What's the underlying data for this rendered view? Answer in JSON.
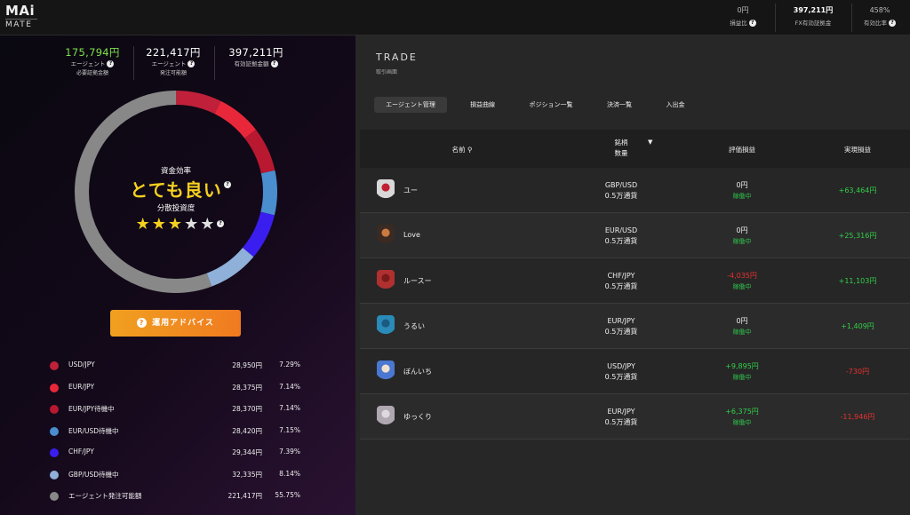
{
  "logo": {
    "line1": "MAi",
    "line2": "MATE"
  },
  "topbar": {
    "stats": [
      {
        "value": "0円",
        "label": "損益比"
      },
      {
        "value": "397,211円",
        "label": "FX有効証拠金"
      },
      {
        "value": "458%",
        "label": "有効比率"
      }
    ]
  },
  "kpis": [
    {
      "value": "175,794円",
      "label1": "エージェント",
      "label2": "必要証拠金額",
      "color": "#7fe04a"
    },
    {
      "value": "221,417円",
      "label1": "エージェント",
      "label2": "発注可能額",
      "color": "#ffffff"
    },
    {
      "value": "397,211円",
      "label1": "有効証拠金額",
      "label2": "",
      "color": "#ffffff"
    }
  ],
  "efficiency": {
    "label": "資金効率",
    "rating": "とても良い",
    "diversification_label": "分散投資度",
    "stars": 3,
    "stars_max": 5
  },
  "advice_button": "運用アドバイス",
  "allocation": [
    {
      "name": "USD/JPY",
      "amount": "28,950円",
      "pct": "7.29%",
      "share": 7.29,
      "color": "#c0203a"
    },
    {
      "name": "EUR/JPY",
      "amount": "28,375円",
      "pct": "7.14%",
      "share": 7.14,
      "color": "#e8283a"
    },
    {
      "name": "EUR/JPY待機中",
      "amount": "28,370円",
      "pct": "7.14%",
      "share": 7.14,
      "color": "#b81830"
    },
    {
      "name": "EUR/USD待機中",
      "amount": "28,420円",
      "pct": "7.15%",
      "share": 7.15,
      "color": "#4a8ed0"
    },
    {
      "name": "CHF/JPY",
      "amount": "29,344円",
      "pct": "7.39%",
      "share": 7.39,
      "color": "#3a1ef0"
    },
    {
      "name": "GBP/USD待機中",
      "amount": "32,335円",
      "pct": "8.14%",
      "share": 8.14,
      "color": "#8fb0d8"
    },
    {
      "name": "エージェント発注可能額",
      "amount": "221,417円",
      "pct": "55.75%",
      "share": 55.75,
      "color": "#888888"
    }
  ],
  "trade": {
    "title": "TRADE",
    "subtitle": "取引画面",
    "tabs": [
      "エージェント管理",
      "損益曲線",
      "ポジション一覧",
      "決済一覧",
      "入出金"
    ],
    "columns": {
      "name": "名前",
      "pair_top": "銘柄",
      "pair_bottom": "数量",
      "unrealized": "評価損益",
      "realized": "実現損益"
    },
    "rows": [
      {
        "name": "ユー",
        "pair": "GBP/USD",
        "qty": "0.5万通貨",
        "unrealized": "0円",
        "unrealized_sign": "zero",
        "status": "稼働中",
        "realized": "+63,464円",
        "realized_sign": "pos",
        "avatar_color": "#d8d8d8",
        "avatar_accent": "#c02030"
      },
      {
        "name": "Love",
        "pair": "EUR/USD",
        "qty": "0.5万通貨",
        "unrealized": "0円",
        "unrealized_sign": "zero",
        "status": "稼働中",
        "realized": "+25,316円",
        "realized_sign": "pos",
        "avatar_color": "#3a2a22",
        "avatar_accent": "#c87a40"
      },
      {
        "name": "ルースー",
        "pair": "CHF/JPY",
        "qty": "0.5万通貨",
        "unrealized": "-4,035円",
        "unrealized_sign": "neg",
        "status": "稼働中",
        "realized": "+11,103円",
        "realized_sign": "pos",
        "avatar_color": "#b03030",
        "avatar_accent": "#7a1a1a"
      },
      {
        "name": "うるい",
        "pair": "EUR/JPY",
        "qty": "0.5万通貨",
        "unrealized": "0円",
        "unrealized_sign": "zero",
        "status": "稼働中",
        "realized": "+1,409円",
        "realized_sign": "pos",
        "avatar_color": "#2a8ab8",
        "avatar_accent": "#1a5a80"
      },
      {
        "name": "ぼんいち",
        "pair": "USD/JPY",
        "qty": "0.5万通貨",
        "unrealized": "+9,895円",
        "unrealized_sign": "pos",
        "status": "稼働中",
        "realized": "-730円",
        "realized_sign": "neg",
        "avatar_color": "#4a78d0",
        "avatar_accent": "#f0e0d0"
      },
      {
        "name": "ゆっくり",
        "pair": "EUR/JPY",
        "qty": "0.5万通貨",
        "unrealized": "+6,375円",
        "unrealized_sign": "pos",
        "status": "稼働中",
        "realized": "-11,946円",
        "realized_sign": "neg",
        "avatar_color": "#b0a8b0",
        "avatar_accent": "#e0d8e0"
      }
    ]
  }
}
